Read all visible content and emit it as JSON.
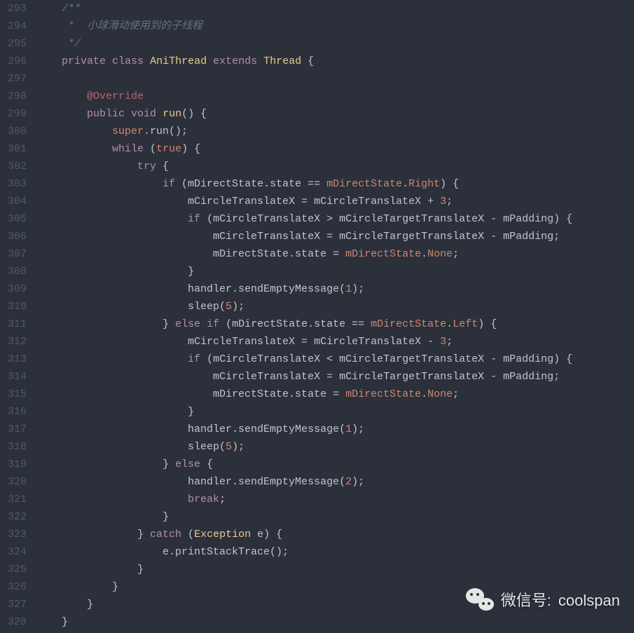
{
  "startLine": 293,
  "endLine": 328,
  "watermark": {
    "label": "微信号:",
    "account": "coolspan"
  },
  "tokens": {
    "comment_open": "/**",
    "comment_body": " *  小球滑动使用到的子线程",
    "comment_close": " */",
    "kw_private": "private",
    "kw_class": "class",
    "kw_extends": "extends",
    "kw_public": "public",
    "kw_void": "void",
    "kw_super": "super",
    "kw_while": "while",
    "kw_true": "true",
    "kw_try": "try",
    "kw_if": "if",
    "kw_else": "else",
    "kw_catch": "catch",
    "kw_break": "break",
    "cls_AniThread": "AniThread",
    "cls_Thread": "Thread",
    "cls_Exception": "Exception",
    "ann_Override": "@Override",
    "m_run": "run",
    "id_mDirectState": "mDirectState",
    "id_state": "state",
    "id_Right": "Right",
    "id_Left": "Left",
    "id_None": "None",
    "id_mCircleTranslateX": "mCircleTranslateX",
    "id_mCircleTargetTranslateX": "mCircleTargetTranslateX",
    "id_mPadding": "mPadding",
    "id_handler": "handler",
    "id_sendEmptyMessage": "sendEmptyMessage",
    "id_sleep": "sleep",
    "id_e": "e",
    "id_printStackTrace": "printStackTrace",
    "n3": "3",
    "n5": "5",
    "n1": "1",
    "n2": "2"
  }
}
